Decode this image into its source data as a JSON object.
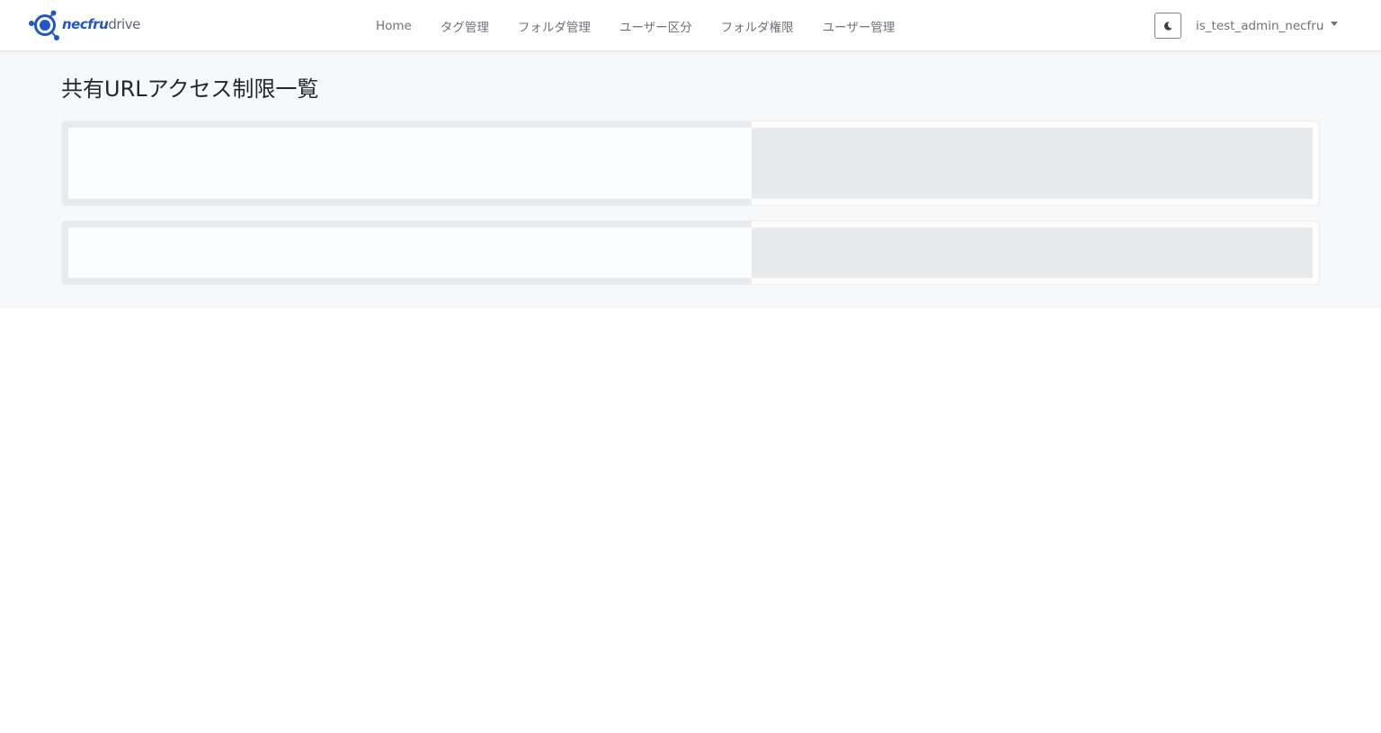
{
  "brand": {
    "name_main": "necfru",
    "name_sub": "drive",
    "logo_icon": "necfru-orbit-logo-icon",
    "color": "#1f56c9"
  },
  "nav": {
    "items": [
      {
        "label": "Home"
      },
      {
        "label": "タグ管理"
      },
      {
        "label": "フォルダ管理"
      },
      {
        "label": "ユーザー区分"
      },
      {
        "label": "フォルダ権限"
      },
      {
        "label": "ユーザー管理"
      }
    ]
  },
  "header": {
    "theme_toggle_icon": "moon-icon",
    "user_name": "is_test_admin_necfru",
    "user_menu_icon": "caret-down-icon"
  },
  "page": {
    "title": "共有URLアクセス制限一覧"
  },
  "loading": {
    "placeholder_cards": 2
  },
  "colors": {
    "background": "#f7f8fa",
    "nav_text": "#6c737a",
    "title_text": "#23272b",
    "skeleton": "#e9eaec"
  }
}
